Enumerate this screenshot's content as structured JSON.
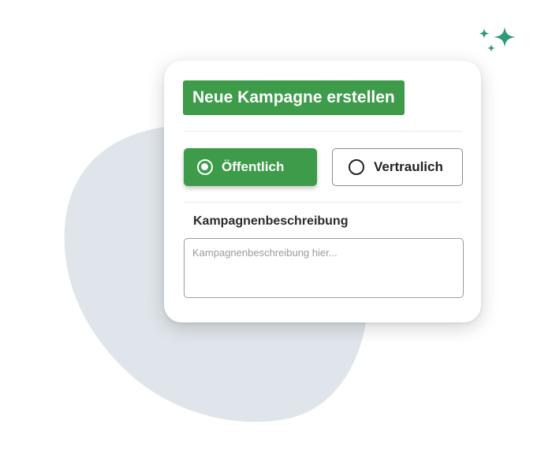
{
  "colors": {
    "brand_green": "#3d9b4a",
    "sparkle_teal": "#2e9a78",
    "blob_gray": "#dfe5ea"
  },
  "decorations": {
    "sparkles_icon": "sparkles-icon",
    "background_shape": "blob-shape"
  },
  "card": {
    "title": "Neue Kampagne erstellen",
    "visibility_options": [
      {
        "label": "Öffentlich",
        "selected": true
      },
      {
        "label": "Vertraulich",
        "selected": false
      }
    ],
    "description": {
      "label": "Kampagnenbeschreibung",
      "value": "",
      "placeholder": "Kampagnenbeschreibung hier..."
    }
  }
}
